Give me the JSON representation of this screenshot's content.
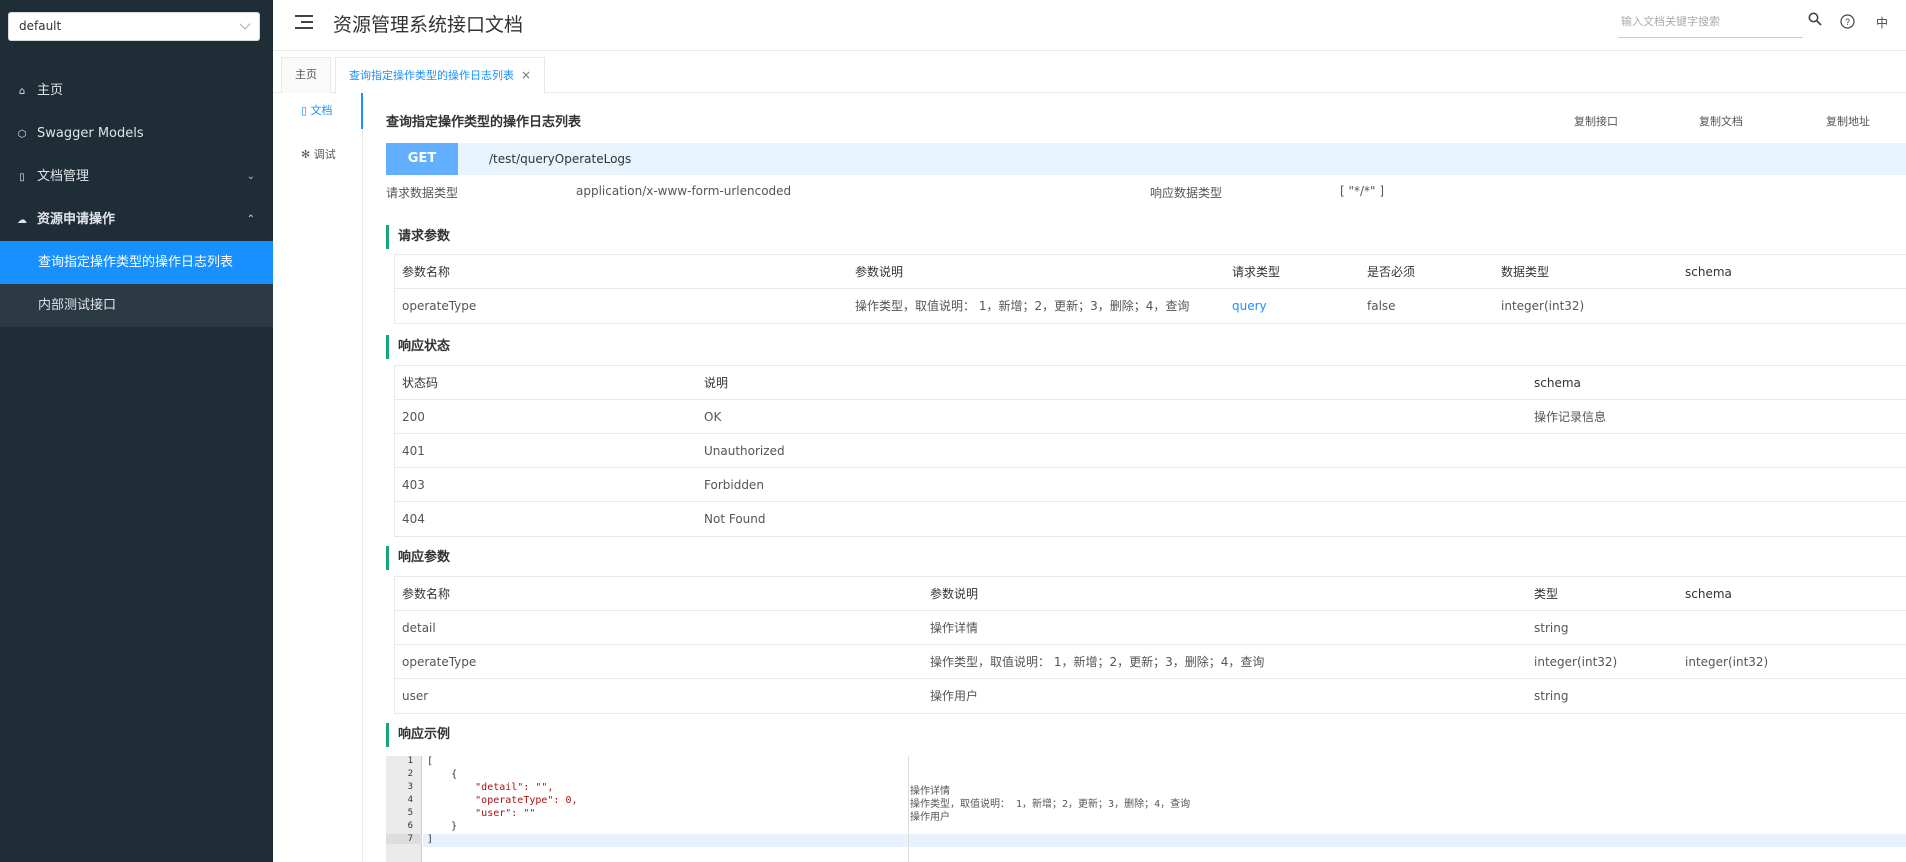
{
  "sidebar": {
    "group_select": "default",
    "items": [
      {
        "label": "主页",
        "icon": "home-icon"
      },
      {
        "label": "Swagger Models",
        "icon": "cube-icon"
      },
      {
        "label": "文档管理",
        "icon": "doc-icon"
      },
      {
        "label": "资源申请操作",
        "icon": "cloud-icon"
      }
    ],
    "sub_items": [
      {
        "label": "查询指定操作类型的操作日志列表",
        "active": true
      },
      {
        "label": "内部测试接口",
        "active": false
      }
    ]
  },
  "header": {
    "title": "资源管理系统接口文档",
    "search_placeholder": "输入文档关键字搜索",
    "lang": "中"
  },
  "tabs": [
    {
      "label": "主页"
    },
    {
      "label": "查询指定操作类型的操作日志列表",
      "active": true
    }
  ],
  "inner_tabs": [
    {
      "label": "文档",
      "icon": "document-icon"
    },
    {
      "label": "调试",
      "icon": "bug-icon"
    }
  ],
  "api": {
    "title": "查询指定操作类型的操作日志列表",
    "copy_api": "复制接口",
    "copy_doc": "复制文档",
    "copy_url": "复制地址",
    "method": "GET",
    "path": "/test/queryOperateLogs",
    "request_type_label": "请求数据类型",
    "request_type": "application/x-www-form-urlencoded",
    "response_type_label": "响应数据类型",
    "response_type": "[ \"*/*\" ]"
  },
  "request_params": {
    "title": "请求参数",
    "headers": [
      "参数名称",
      "参数说明",
      "请求类型",
      "是否必须",
      "数据类型",
      "schema"
    ],
    "rows": [
      [
        "operateType",
        "操作类型，取值说明： 1，新增；2，更新；3，删除；4，查询",
        "query",
        "false",
        "integer(int32)",
        ""
      ]
    ]
  },
  "response_status": {
    "title": "响应状态",
    "headers": [
      "状态码",
      "说明",
      "schema"
    ],
    "rows": [
      [
        "200",
        "OK",
        "操作记录信息"
      ],
      [
        "401",
        "Unauthorized",
        ""
      ],
      [
        "403",
        "Forbidden",
        ""
      ],
      [
        "404",
        "Not Found",
        ""
      ]
    ]
  },
  "response_params": {
    "title": "响应参数",
    "headers": [
      "参数名称",
      "参数说明",
      "类型",
      "schema"
    ],
    "rows": [
      [
        "detail",
        "操作详情",
        "string",
        ""
      ],
      [
        "operateType",
        "操作类型，取值说明： 1，新增；2，更新；3，删除；4，查询",
        "integer(int32)",
        "integer(int32)"
      ],
      [
        "user",
        "操作用户",
        "string",
        ""
      ]
    ]
  },
  "response_example": {
    "title": "响应示例",
    "line_numbers": [
      "1",
      "2",
      "3",
      "4",
      "5",
      "6",
      "7"
    ],
    "lines": [
      "[",
      "    {",
      "        \"detail\": \"\",",
      "        \"operateType\": 0,",
      "        \"user\": \"\"",
      "    }",
      "]"
    ],
    "comments": [
      "操作详情",
      "操作类型，取值说明： 1，新增；2，更新；3，删除；4，查询",
      "操作用户"
    ]
  }
}
